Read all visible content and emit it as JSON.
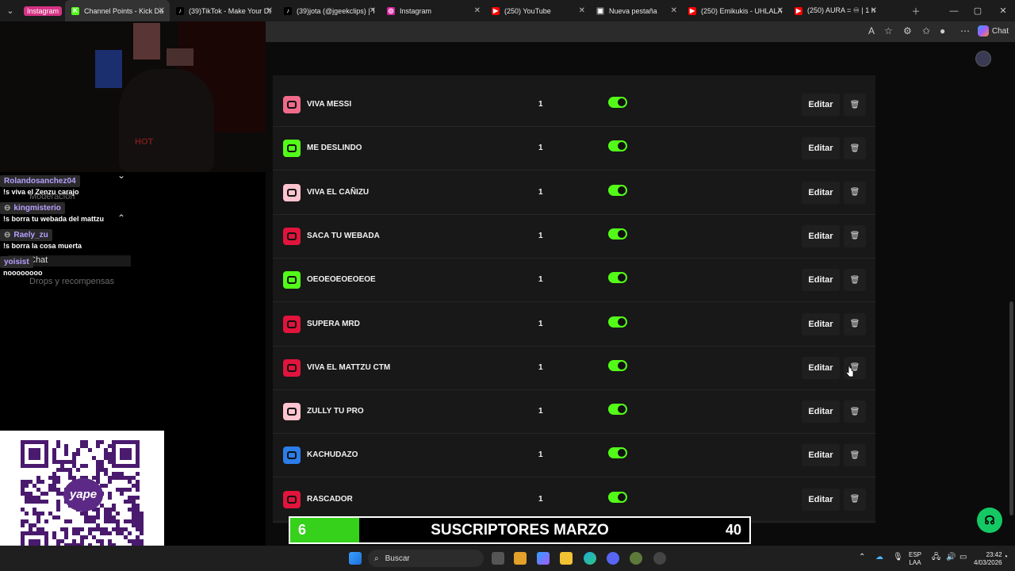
{
  "browser": {
    "tab_group": "Instagram",
    "tabs": [
      {
        "title": "Channel Points - Kick Dash",
        "active": true,
        "fav": "K",
        "color": "#53fc18"
      },
      {
        "title": "(39)TikTok - Make Your Da",
        "active": false,
        "fav": "♪",
        "color": "#000000"
      },
      {
        "title": "(39)jota (@jgeekclips) | Tik",
        "active": false,
        "fav": "♪",
        "color": "#000000"
      },
      {
        "title": "Instagram",
        "active": false,
        "fav": "◎",
        "color": "#d6249f"
      },
      {
        "title": "(250) YouTube",
        "active": false,
        "fav": "▶",
        "color": "#ff0000"
      },
      {
        "title": "Nueva pestaña",
        "active": false,
        "fav": "▣",
        "color": "#555555"
      },
      {
        "title": "(250) Emikukis - UHLALAL",
        "active": false,
        "fav": "▶",
        "color": "#ff0000"
      },
      {
        "title": "(250) AURA = ♾ | 1 h",
        "active": false,
        "fav": "▶",
        "color": "#ff0000"
      }
    ],
    "chat_button": "Chat"
  },
  "chat_overlay": [
    {
      "user": "Rolandosanchez04",
      "message": "!s viva el Zenzu carajo",
      "badge": false
    },
    {
      "user": "kingmisterio",
      "message": "!s borra tu webada del mattzu",
      "badge": true
    },
    {
      "user": "Raely_zu",
      "message": "!s borra la cosa muerta",
      "badge": true
    },
    {
      "user": "yoisist",
      "message": "noooooooo",
      "badge": false
    }
  ],
  "sidebar_ghost": {
    "moderacion": "Moderación",
    "chat": "Chat",
    "drops": "Drops y recompensas"
  },
  "rewards": [
    {
      "name": "VIVA MESSI",
      "cost": "1",
      "enabled": true,
      "color": "#f06a8a"
    },
    {
      "name": "ME DESLINDO",
      "cost": "1",
      "enabled": true,
      "color": "#53fc18"
    },
    {
      "name": "VIVA EL CAÑIZU",
      "cost": "1",
      "enabled": true,
      "color": "#ffc4d0"
    },
    {
      "name": "SACA TU WEBADA",
      "cost": "1",
      "enabled": true,
      "color": "#e0143c"
    },
    {
      "name": "OEOEOEOEOEOE",
      "cost": "1",
      "enabled": true,
      "color": "#53fc18"
    },
    {
      "name": "SUPERA MRD",
      "cost": "1",
      "enabled": true,
      "color": "#e0143c"
    },
    {
      "name": "VIVA EL MATTZU CTM",
      "cost": "1",
      "enabled": true,
      "color": "#e0143c"
    },
    {
      "name": "ZULLY TU PRO",
      "cost": "1",
      "enabled": true,
      "color": "#ffc4d0"
    },
    {
      "name": "KACHUDAZO",
      "cost": "1",
      "enabled": true,
      "color": "#2b7de9"
    },
    {
      "name": "RASCADOR",
      "cost": "1",
      "enabled": true,
      "color": "#e0143c"
    }
  ],
  "labels": {
    "edit": "Editar",
    "delete_icon": "🗑"
  },
  "subs_goal": {
    "current": "6",
    "label": "SUSCRIPTORES MARZO",
    "goal": "40",
    "progress_fraction": 0.15
  },
  "taskbar": {
    "search_placeholder": "Buscar",
    "lang_1": "ESP",
    "lang_2": "LAA",
    "time": "23:42",
    "date": "4/03/2026"
  },
  "qr_brand": "yape",
  "webcam_shirt": "HOT"
}
